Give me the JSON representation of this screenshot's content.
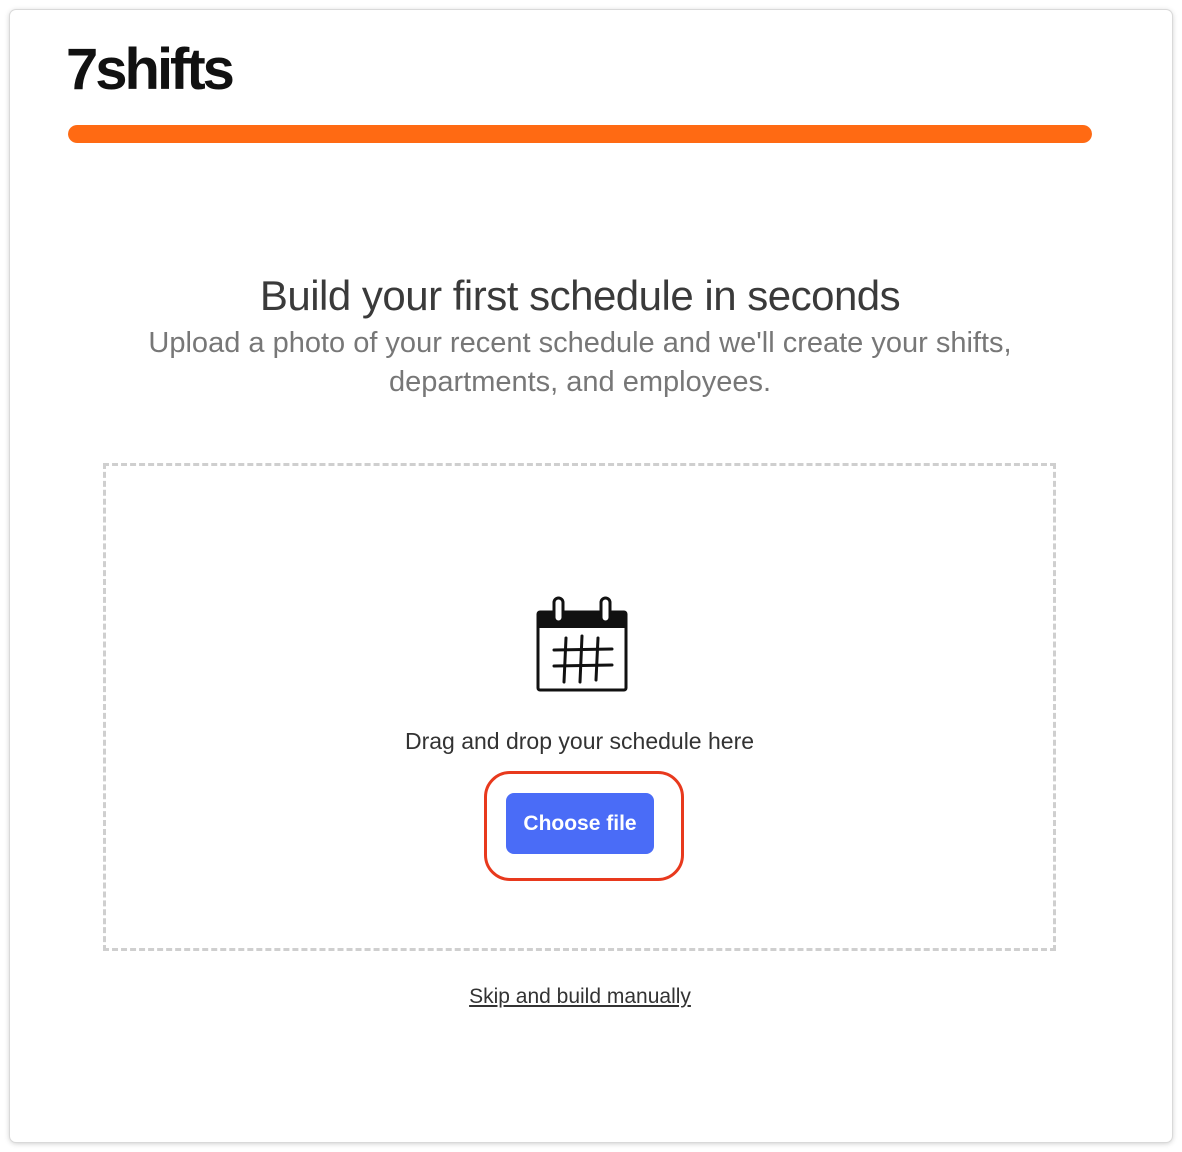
{
  "header": {
    "logo_text": "7shifts"
  },
  "progress": {
    "value_percent": 100,
    "color": "#ff6a13"
  },
  "main": {
    "title": "Build your first schedule in seconds",
    "subtitle": "Upload a photo of your recent schedule and we'll create your shifts, departments, and employees."
  },
  "upload": {
    "icon": "calendar-icon",
    "drop_text": "Drag and drop your schedule here",
    "choose_label": "Choose file",
    "button_color": "#4a6cf7",
    "highlight_color": "#e8391d"
  },
  "footer": {
    "skip_label": "Skip and build manually"
  }
}
